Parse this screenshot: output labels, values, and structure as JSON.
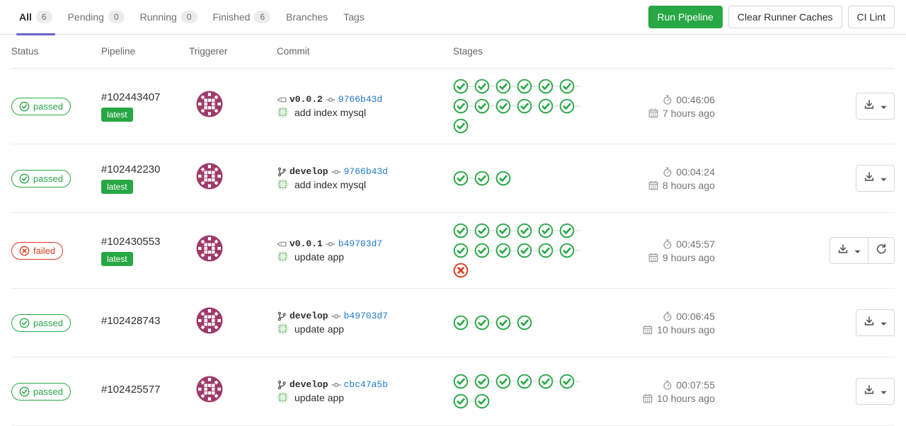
{
  "tabs": [
    {
      "label": "All",
      "count": "6"
    },
    {
      "label": "Pending",
      "count": "0"
    },
    {
      "label": "Running",
      "count": "0"
    },
    {
      "label": "Finished",
      "count": "6"
    },
    {
      "label": "Branches"
    },
    {
      "label": "Tags"
    }
  ],
  "toolbar": {
    "run_pipeline_label": "Run Pipeline",
    "clear_runner_caches_label": "Clear Runner Caches",
    "ci_lint_label": "CI Lint"
  },
  "table_headers": {
    "status": "Status",
    "pipeline": "Pipeline",
    "triggerer": "Triggerer",
    "commit": "Commit",
    "stages": "Stages"
  },
  "rows": [
    {
      "status": "passed",
      "pipeline_id": "#102443407",
      "latest_label": "latest",
      "ref_type": "tag",
      "ref": "v0.0.2",
      "sha": "9766b43d",
      "commit_message": "add index mysql",
      "stages_passed": 13,
      "stages_failed": 0,
      "duration": "00:46:06",
      "age": "7 hours ago",
      "can_retry": false
    },
    {
      "status": "passed",
      "pipeline_id": "#102442230",
      "latest_label": "latest",
      "ref_type": "branch",
      "ref": "develop",
      "sha": "9766b43d",
      "commit_message": "add index mysql",
      "stages_passed": 3,
      "stages_failed": 0,
      "duration": "00:04:24",
      "age": "8 hours ago",
      "can_retry": false
    },
    {
      "status": "failed",
      "pipeline_id": "#102430553",
      "latest_label": "latest",
      "ref_type": "tag",
      "ref": "v0.0.1",
      "sha": "b49703d7",
      "commit_message": "update app",
      "stages_passed": 12,
      "stages_failed": 1,
      "duration": "00:45:57",
      "age": "9 hours ago",
      "can_retry": true
    },
    {
      "status": "passed",
      "pipeline_id": "#102428743",
      "ref_type": "branch",
      "ref": "develop",
      "sha": "b49703d7",
      "commit_message": "update app",
      "stages_passed": 4,
      "stages_failed": 0,
      "duration": "00:06:45",
      "age": "10 hours ago",
      "can_retry": false
    },
    {
      "status": "passed",
      "pipeline_id": "#102425577",
      "ref_type": "branch",
      "ref": "develop",
      "sha": "cbc47a5b",
      "commit_message": "update app",
      "stages_passed": 8,
      "stages_failed": 0,
      "duration": "00:07:55",
      "age": "10 hours ago",
      "can_retry": false
    }
  ],
  "colors": {
    "success_green": "#28a745",
    "failed_red": "#db3b21",
    "link_blue": "#1f78d1",
    "active_tab_indigo": "#6666c4"
  }
}
